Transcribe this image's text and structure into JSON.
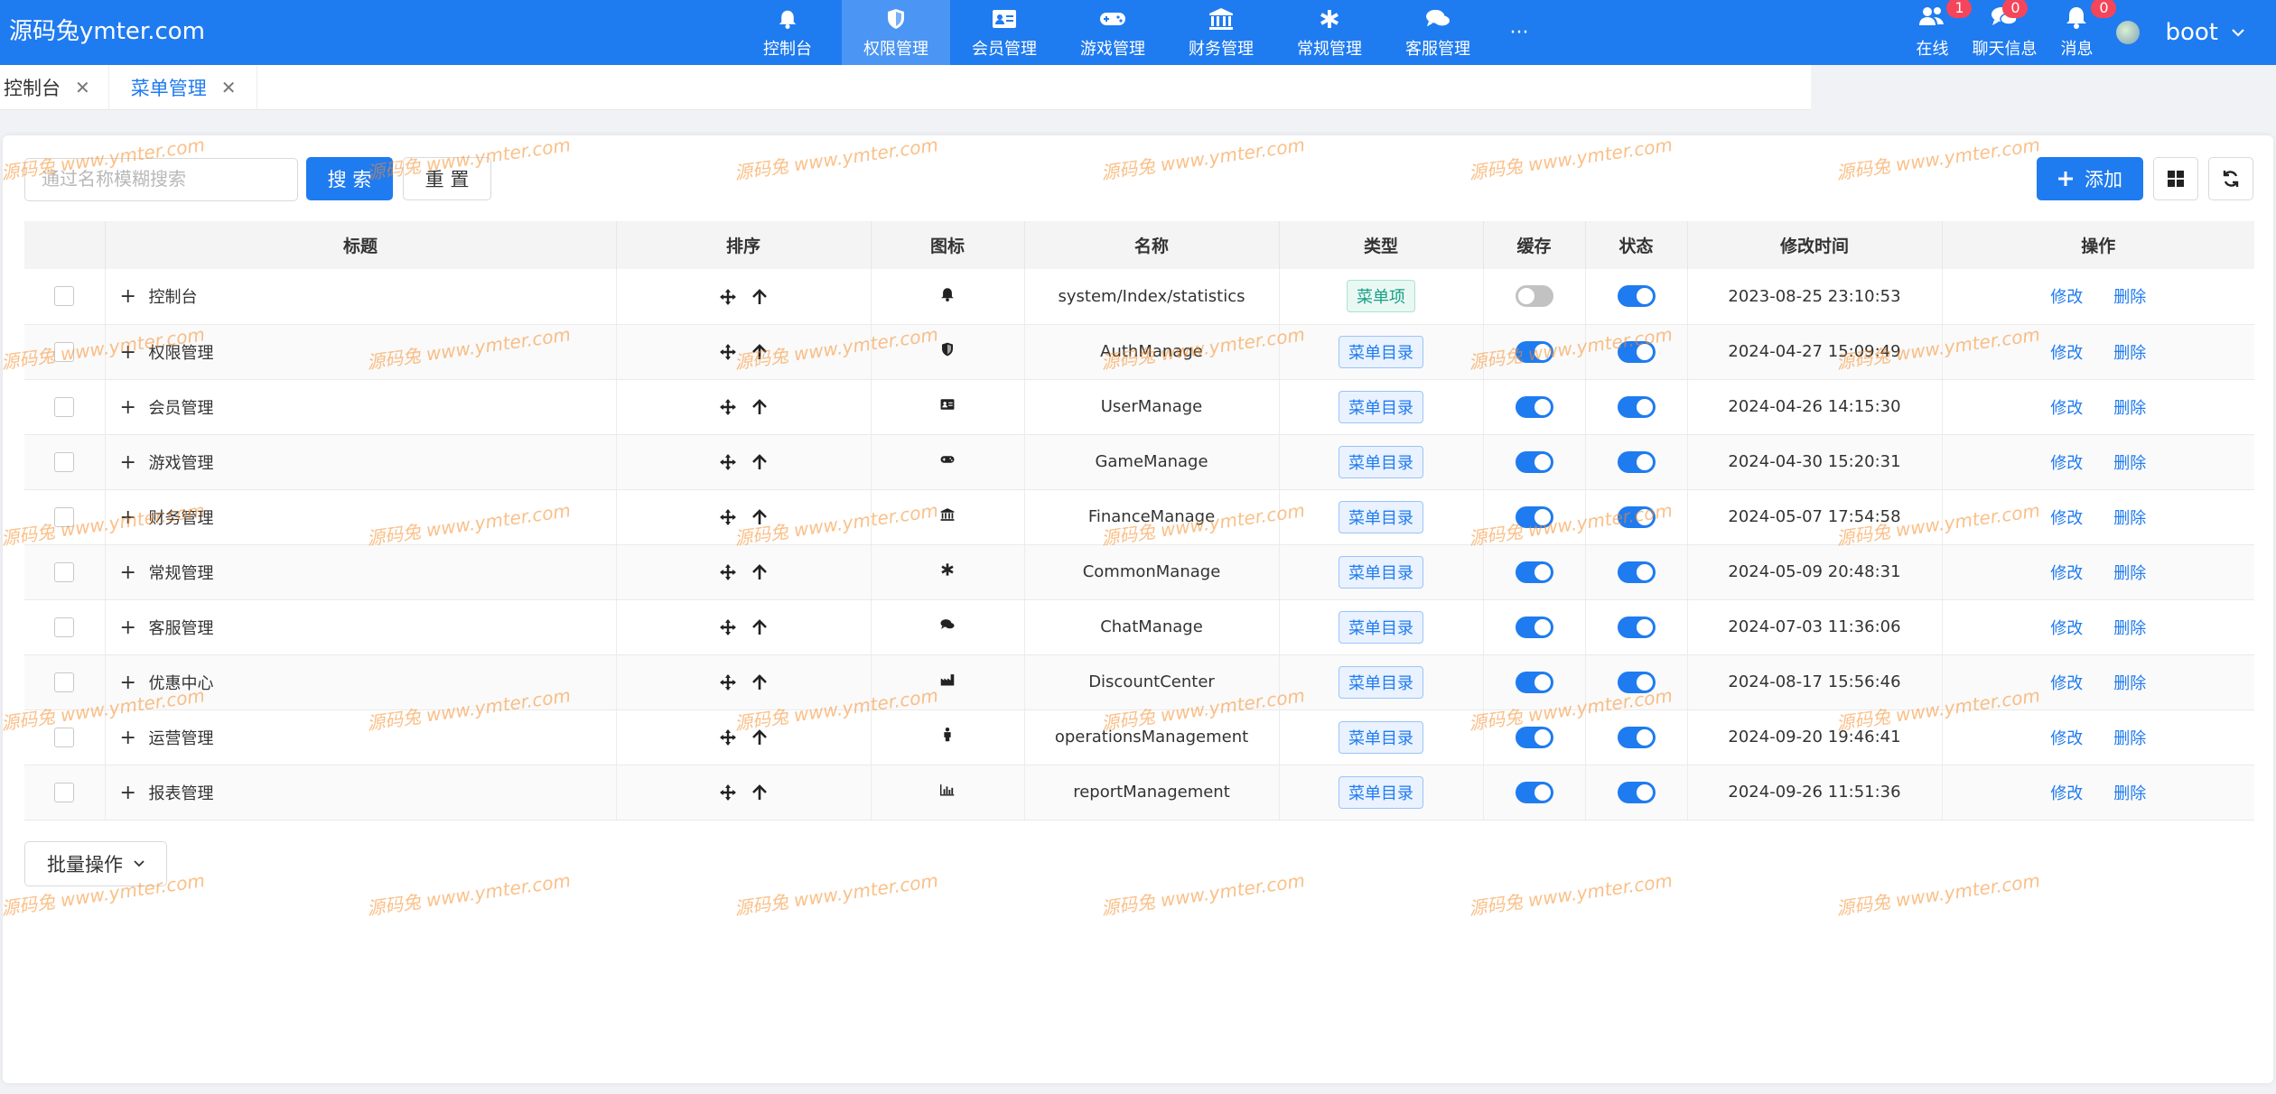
{
  "brand": "源码兔ymter.com",
  "nav": [
    {
      "label": "控制台",
      "icon": "bell-icon",
      "active": false
    },
    {
      "label": "权限管理",
      "icon": "shield-icon",
      "active": true
    },
    {
      "label": "会员管理",
      "icon": "id-card-icon",
      "active": false
    },
    {
      "label": "游戏管理",
      "icon": "gamepad-icon",
      "active": false
    },
    {
      "label": "财务管理",
      "icon": "bank-icon",
      "active": false
    },
    {
      "label": "常规管理",
      "icon": "asterisk-icon",
      "active": false
    },
    {
      "label": "客服管理",
      "icon": "chat-icon",
      "active": false
    }
  ],
  "nav_more": "···",
  "tools": {
    "online": {
      "label": "在线",
      "badge": "1"
    },
    "chat": {
      "label": "聊天信息",
      "badge": "0"
    },
    "messages": {
      "label": "消息",
      "badge": "0"
    },
    "user": "boot"
  },
  "tabs": [
    {
      "label": "控制台"
    },
    {
      "label": "菜单管理"
    }
  ],
  "search": {
    "placeholder": "通过名称模糊搜索",
    "search_label": "搜 索",
    "reset_label": "重 置"
  },
  "actions": {
    "add_label": "添加"
  },
  "columns": [
    "标题",
    "排序",
    "图标",
    "名称",
    "类型",
    "缓存",
    "状态",
    "修改时间",
    "操作"
  ],
  "rows": [
    {
      "title": "控制台",
      "icon": "bell-icon",
      "name": "system/Index/statistics",
      "type": "菜单项",
      "cache": false,
      "status": true,
      "time": "2023-08-25 23:10:53"
    },
    {
      "title": "权限管理",
      "icon": "shield-icon",
      "name": "AuthManage",
      "type": "菜单目录",
      "cache": true,
      "status": true,
      "time": "2024-04-27 15:09:49"
    },
    {
      "title": "会员管理",
      "icon": "id-card-icon",
      "name": "UserManage",
      "type": "菜单目录",
      "cache": true,
      "status": true,
      "time": "2024-04-26 14:15:30"
    },
    {
      "title": "游戏管理",
      "icon": "gamepad-icon",
      "name": "GameManage",
      "type": "菜单目录",
      "cache": true,
      "status": true,
      "time": "2024-04-30 15:20:31"
    },
    {
      "title": "财务管理",
      "icon": "bank-icon",
      "name": "FinanceManage",
      "type": "菜单目录",
      "cache": true,
      "status": true,
      "time": "2024-05-07 17:54:58"
    },
    {
      "title": "常规管理",
      "icon": "asterisk-icon",
      "name": "CommonManage",
      "type": "菜单目录",
      "cache": true,
      "status": true,
      "time": "2024-05-09 20:48:31"
    },
    {
      "title": "客服管理",
      "icon": "chat-icon",
      "name": "ChatManage",
      "type": "菜单目录",
      "cache": true,
      "status": true,
      "time": "2024-07-03 11:36:06"
    },
    {
      "title": "优惠中心",
      "icon": "industry-icon",
      "name": "DiscountCenter",
      "type": "菜单目录",
      "cache": true,
      "status": true,
      "time": "2024-08-17 15:56:46"
    },
    {
      "title": "运营管理",
      "icon": "person-icon",
      "name": "operationsManagement",
      "type": "菜单目录",
      "cache": true,
      "status": true,
      "time": "2024-09-20 19:46:41"
    },
    {
      "title": "报表管理",
      "icon": "bar-chart-icon",
      "name": "reportManagement",
      "type": "菜单目录",
      "cache": true,
      "status": true,
      "time": "2024-09-26 11:51:36"
    }
  ],
  "row_actions": {
    "edit": "修改",
    "delete": "删除"
  },
  "batch_label": "批量操作",
  "watermark": "源码兔  www.ymter.com"
}
